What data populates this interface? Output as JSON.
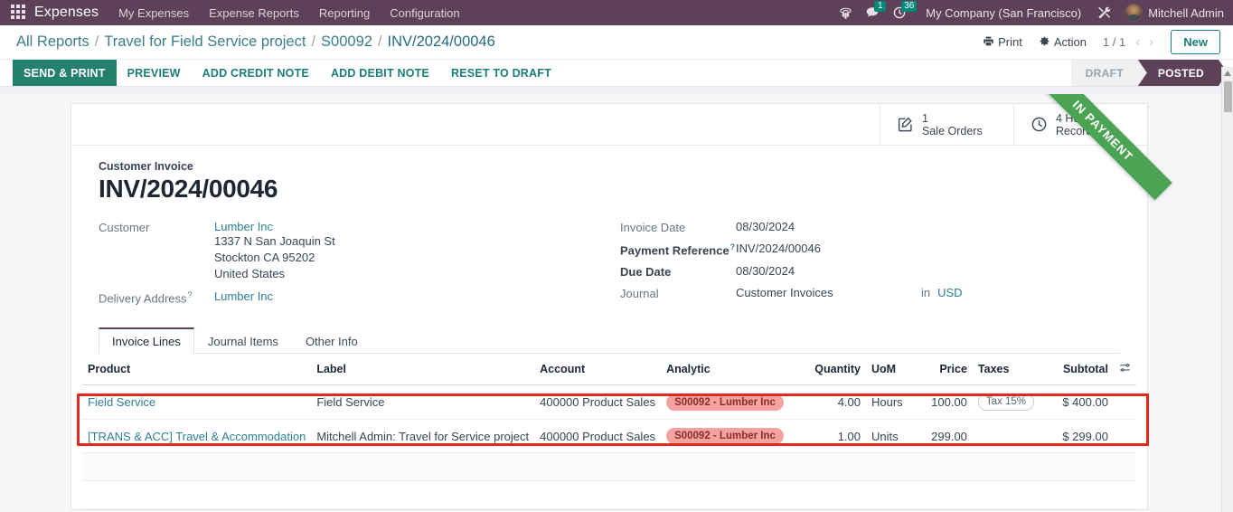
{
  "navbar": {
    "apps_icon": "apps-grid-icon",
    "brand": "Expenses",
    "menu": [
      {
        "label": "My Expenses"
      },
      {
        "label": "Expense Reports"
      },
      {
        "label": "Reporting"
      },
      {
        "label": "Configuration"
      }
    ],
    "icons": {
      "voip": "phone-dialpad-icon",
      "messages": "chat-bubble-icon",
      "messages_badge": "1",
      "activities": "clock-activity-icon",
      "activities_badge": "36",
      "debug": "tools-wrench-icon"
    },
    "company": "My Company (San Francisco)",
    "user": "Mitchell Admin"
  },
  "control_panel": {
    "breadcrumb": [
      {
        "label": "All Reports"
      },
      {
        "label": "Travel for Field Service project"
      },
      {
        "label": "S00092"
      },
      {
        "label": "INV/2024/00046"
      }
    ],
    "separator": "/",
    "print_label": "Print",
    "action_label": "Action",
    "pager": "1 / 1",
    "prev_arrow": "‹",
    "next_arrow": "›",
    "new_label": "New"
  },
  "statusbar": {
    "buttons": [
      {
        "label": "SEND & PRINT",
        "primary": true
      },
      {
        "label": "PREVIEW",
        "primary": false
      },
      {
        "label": "ADD CREDIT NOTE",
        "primary": false
      },
      {
        "label": "ADD DEBIT NOTE",
        "primary": false
      },
      {
        "label": "RESET TO DRAFT",
        "primary": false
      }
    ],
    "pipeline": [
      {
        "label": "DRAFT",
        "active": false
      },
      {
        "label": "POSTED",
        "active": true
      }
    ]
  },
  "smart_buttons": [
    {
      "icon": "pencil-square-icon",
      "value": "1",
      "label": "Sale Orders"
    },
    {
      "icon": "clock-icon",
      "value": "4 Hours",
      "label": "Recorded"
    }
  ],
  "ribbon": {
    "text": "IN PAYMENT",
    "color": "#4ba354"
  },
  "form": {
    "title_label": "Customer Invoice",
    "title": "INV/2024/00046",
    "customer_label": "Customer",
    "customer_name": "Lumber Inc",
    "customer_address": [
      "1337 N San Joaquin St",
      "Stockton CA 95202",
      "United States"
    ],
    "delivery_label": "Delivery Address",
    "delivery_help": "?",
    "delivery_value": "Lumber Inc",
    "invoice_date_label": "Invoice Date",
    "invoice_date": "08/30/2024",
    "payment_ref_label": "Payment Reference",
    "payment_ref_help": "?",
    "payment_ref": "INV/2024/00046",
    "due_date_label": "Due Date",
    "due_date": "08/30/2024",
    "journal_label": "Journal",
    "journal": "Customer Invoices",
    "currency_prefix": "in",
    "currency": "USD"
  },
  "notebook": {
    "tabs": [
      {
        "label": "Invoice Lines",
        "active": true
      },
      {
        "label": "Journal Items",
        "active": false
      },
      {
        "label": "Other Info",
        "active": false
      }
    ]
  },
  "lines": {
    "columns": [
      "Product",
      "Label",
      "Account",
      "Analytic",
      "Quantity",
      "UoM",
      "Price",
      "Taxes",
      "Subtotal"
    ],
    "optional_columns_icon": "column-options-icon",
    "rows": [
      {
        "product": "Field Service",
        "label": "Field Service",
        "account": "400000 Product Sales",
        "analytic": "S00092 - Lumber Inc",
        "quantity": "4.00",
        "uom": "Hours",
        "price": "100.00",
        "taxes": "Tax 15%",
        "subtotal": "$ 400.00"
      },
      {
        "product": "[TRANS & ACC] Travel & Accommodation",
        "label": "Mitchell Admin: Travel for Service project",
        "account": "400000 Product Sales",
        "analytic": "S00092 - Lumber Inc",
        "quantity": "1.00",
        "uom": "Units",
        "price": "299.00",
        "taxes": "",
        "subtotal": "$ 299.00"
      }
    ]
  },
  "colors": {
    "navbar": "#5c4158",
    "primary": "#24806d",
    "link": "#2e7f97",
    "annotation": "#e02a1d",
    "tag": "#f4a3a0",
    "ribbon": "#4ba354"
  }
}
